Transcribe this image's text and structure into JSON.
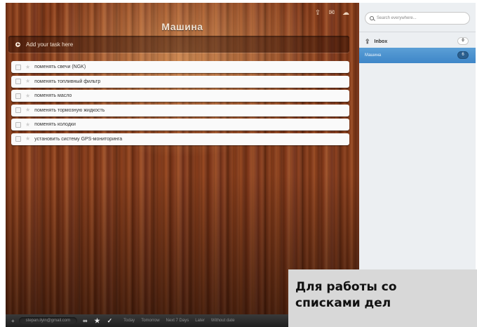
{
  "list": {
    "title": "Машина",
    "add_placeholder": "Add your task here",
    "tasks": [
      "поменять свечи (NGK)",
      "поменять топливный фильтр",
      "поменять масло",
      "поменять тормозную жидкость",
      "поменять колодки",
      "установить систему GPS-мониторинга"
    ]
  },
  "toolbar": {
    "icons": [
      "share-icon",
      "mail-icon",
      "cloud-icon"
    ]
  },
  "bottom_bar": {
    "add": "+",
    "email": "stepan.ilyin@gmail.com",
    "filters": [
      "Today",
      "Tomorrow",
      "Next 7 Days",
      "Later",
      "Without date"
    ]
  },
  "sidebar": {
    "search_placeholder": "Search everywhere...",
    "inbox": {
      "label": "Inbox",
      "count": "0"
    },
    "list": {
      "label": "Машина",
      "count": "6"
    },
    "accent": "#4a8fcf"
  },
  "caption": {
    "text": "Для работы со\nсписками дел"
  },
  "colors": {
    "wood": "#7a3516",
    "caption_bg": "#d8d8d8"
  }
}
